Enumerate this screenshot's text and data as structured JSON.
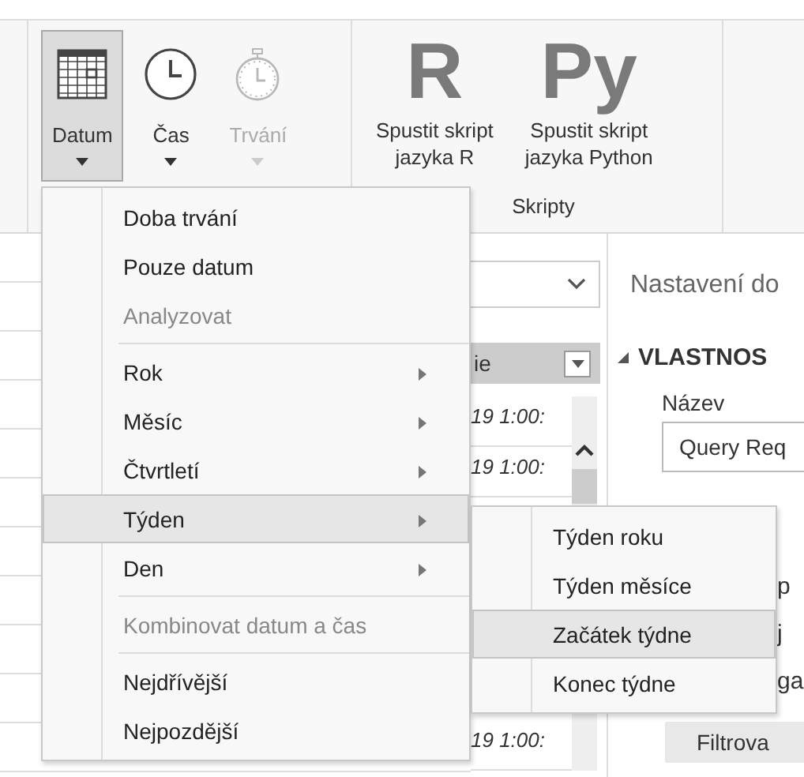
{
  "ribbon": {
    "groups": [
      {
        "buttons": [
          {
            "kind": "calendar",
            "label": "Datum",
            "selected": true,
            "disabled": false
          },
          {
            "kind": "clock",
            "label": "Čas",
            "selected": false,
            "disabled": false
          },
          {
            "kind": "stopwatch",
            "label": "Trvání",
            "selected": false,
            "disabled": true
          }
        ]
      },
      {
        "label": "Skripty",
        "buttons": [
          {
            "kind": "glyph",
            "glyph": "R",
            "label": "Spustit skript\njazyka R",
            "selected": false,
            "disabled": false
          },
          {
            "kind": "glyph",
            "glyph": "Py",
            "label": "Spustit skript\njazyka Python",
            "selected": false,
            "disabled": false
          }
        ]
      }
    ]
  },
  "grid": {
    "header": "ie",
    "cells_top": [
      "19 1:00:",
      "19 1:00:"
    ],
    "cells_bottom": [
      "19 1:00:"
    ]
  },
  "panel": {
    "title": "Nastavení do",
    "section": "VLASTNOS",
    "name_label": "Název",
    "name_value": "Query Req",
    "fragments": [
      "p",
      "j",
      "ga"
    ],
    "button": "Filtrova"
  },
  "menu": {
    "items": [
      {
        "kind": "command",
        "label": "Doba trvání",
        "disabled": false,
        "selected": false
      },
      {
        "kind": "command",
        "label": "Pouze datum",
        "disabled": false,
        "selected": false
      },
      {
        "kind": "command",
        "label": "Analyzovat",
        "disabled": true,
        "selected": false
      },
      {
        "kind": "separator"
      },
      {
        "kind": "submenu",
        "label": "Rok",
        "disabled": false,
        "selected": false
      },
      {
        "kind": "submenu",
        "label": "Měsíc",
        "disabled": false,
        "selected": false
      },
      {
        "kind": "submenu",
        "label": "Čtvrtletí",
        "disabled": false,
        "selected": false
      },
      {
        "kind": "submenu",
        "label": "Týden",
        "disabled": false,
        "selected": true
      },
      {
        "kind": "submenu",
        "label": "Den",
        "disabled": false,
        "selected": false
      },
      {
        "kind": "separator"
      },
      {
        "kind": "command",
        "label": "Kombinovat datum a čas",
        "disabled": true,
        "selected": false
      },
      {
        "kind": "separator"
      },
      {
        "kind": "command",
        "label": "Nejdřívější",
        "disabled": false,
        "selected": false
      },
      {
        "kind": "command",
        "label": "Nejpozdější",
        "disabled": false,
        "selected": false
      }
    ]
  },
  "submenu": {
    "items": [
      {
        "kind": "command",
        "label": "Týden roku",
        "disabled": false,
        "selected": false
      },
      {
        "kind": "command",
        "label": "Týden měsíce",
        "disabled": false,
        "selected": false
      },
      {
        "kind": "command",
        "label": "Začátek týdne",
        "disabled": false,
        "selected": true
      },
      {
        "kind": "command",
        "label": "Konec týdne",
        "disabled": false,
        "selected": false
      }
    ]
  }
}
